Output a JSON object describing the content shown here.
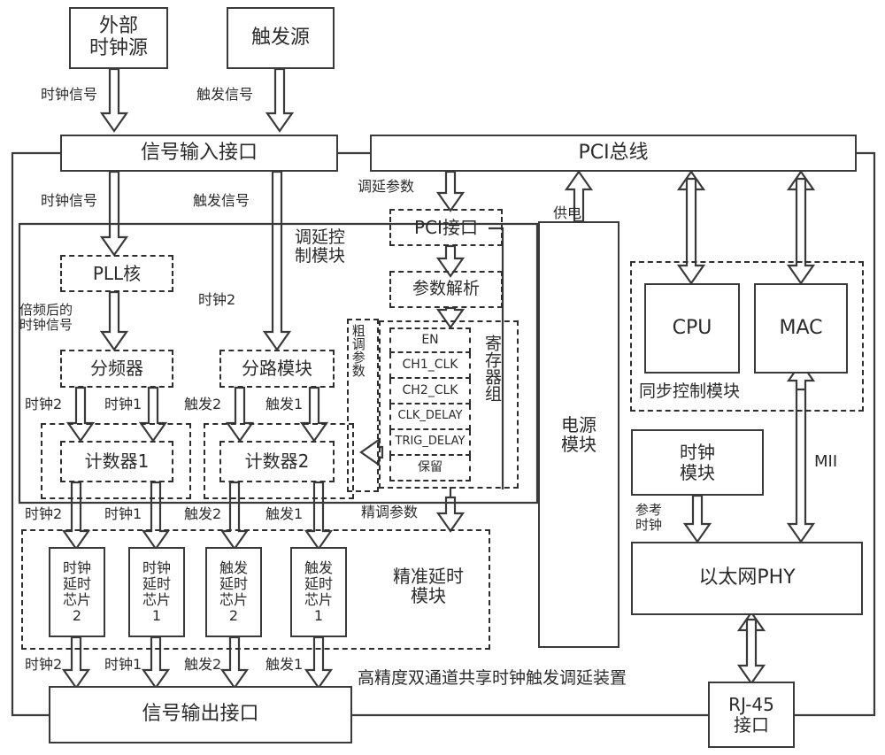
{
  "diagram": {
    "caption": "高精度双通道共享时钟触发调延装置",
    "accent": "#3a3a3a"
  },
  "sources": {
    "external_clock": "外部\n时钟源",
    "external_clock_l1": "外部",
    "external_clock_l2": "时钟源",
    "trigger_source": "触发源"
  },
  "interfaces": {
    "signal_input": "信号输入接口",
    "signal_output": "信号输出接口",
    "pci_bus": "PCI总线",
    "pci_interface": "PCI接口",
    "rj45_l1": "RJ-45",
    "rj45_l2": "接口"
  },
  "delay_control": {
    "module_l1": "调延控",
    "module_l2": "制模块",
    "pll": "PLL核",
    "divider": "分频器",
    "splitter": "分路模块",
    "counter1": "计数器1",
    "counter2": "计数器2",
    "param_parse": "参数解析",
    "register_group": "寄存器组",
    "registers": [
      "EN",
      "CH1_CLK",
      "CH2_CLK",
      "CLK_DELAY",
      "TRIG_DELAY",
      "保留"
    ],
    "coarse_param": "粗调参数"
  },
  "precise_delay": {
    "module_l1": "精准延时",
    "module_l2": "模块",
    "chips": [
      {
        "l1": "时钟",
        "l2": "延时",
        "l3": "芯片",
        "l4": "2"
      },
      {
        "l1": "时钟",
        "l2": "延时",
        "l3": "芯片",
        "l4": "1"
      },
      {
        "l1": "触发",
        "l2": "延时",
        "l3": "芯片",
        "l4": "2"
      },
      {
        "l1": "触发",
        "l2": "延时",
        "l3": "芯片",
        "l4": "1"
      }
    ]
  },
  "sync_control": {
    "module": "同步控制模块",
    "cpu": "CPU",
    "mac": "MAC",
    "mii": "MII"
  },
  "power": {
    "l1": "电源",
    "l2": "模块",
    "supply": "供电"
  },
  "clock_module": {
    "l1": "时钟",
    "l2": "模块",
    "ref_l1": "参考",
    "ref_l2": "时钟"
  },
  "phy": {
    "label": "以太网PHY"
  },
  "signal_labels": {
    "clock_signal": "时钟信号",
    "trigger_signal": "触发信号",
    "clock_signal_2": "时钟信号",
    "trigger_signal_2": "触发信号",
    "delay_param": "调延参数",
    "multiplied_l1": "倍频后的",
    "multiplied_l2": "时钟信号",
    "clock2_top": "时钟2",
    "fine_param": "精调参数",
    "clk2": "时钟2",
    "clk1": "时钟1",
    "trg2": "触发2",
    "trg1": "触发1"
  }
}
